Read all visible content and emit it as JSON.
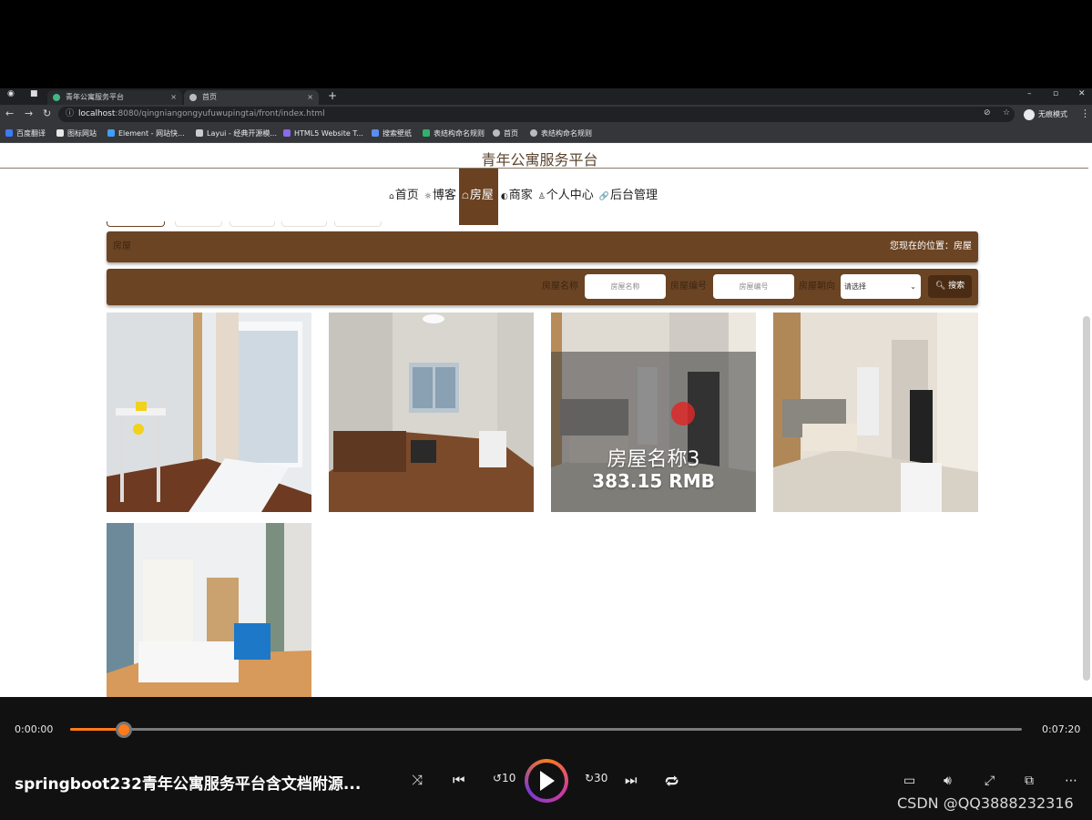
{
  "browser": {
    "tabs": [
      {
        "label": "青年公寓服务平台",
        "close": "×"
      },
      {
        "label": "首页",
        "close": "×"
      }
    ],
    "new_tab": "+",
    "url_host": "localhost",
    "url_path": ":8080/qingniangongyufuwupingtai/front/index.html",
    "profile": "无痕模式",
    "bookmarks": [
      "百度翻译",
      "图标网站",
      "Element - 网站快...",
      "Layui - 经典开源模...",
      "HTML5 Website T...",
      "搜索壁纸",
      "表结构命名规则",
      "首页",
      "表结构命名规则"
    ]
  },
  "site": {
    "title": "青年公寓服务平台",
    "nav": [
      {
        "icon": "⌂",
        "label": "首页"
      },
      {
        "icon": "☼",
        "label": "博客"
      },
      {
        "icon": "☖",
        "label": "房屋"
      },
      {
        "icon": "◐",
        "label": "商家"
      },
      {
        "icon": "♙",
        "label": "个人中心"
      },
      {
        "icon": "🔗",
        "label": "后台管理"
      }
    ]
  },
  "breadcrumb": {
    "left": "房屋",
    "right": "您现在的位置：房屋"
  },
  "search": {
    "name_label": "房屋名称",
    "name_placeholder": "房屋名称",
    "code_label": "房屋编号",
    "code_placeholder": "房屋编号",
    "orient_label": "房屋朝向",
    "orient_value": "请选择",
    "button": "搜索"
  },
  "listings": [
    {
      "id": 1
    },
    {
      "id": 2
    },
    {
      "id": 3,
      "name": "房屋名称3",
      "price": "383.15 RMB"
    },
    {
      "id": 4
    },
    {
      "id": 5
    }
  ],
  "player": {
    "current": "0:00:00",
    "total": "0:07:20",
    "progress": 0.05,
    "title": "springboot232青年公寓服务平台含文档附源...",
    "accent": "#ff7b1a",
    "watermark": "CSDN @QQ3888232316"
  }
}
